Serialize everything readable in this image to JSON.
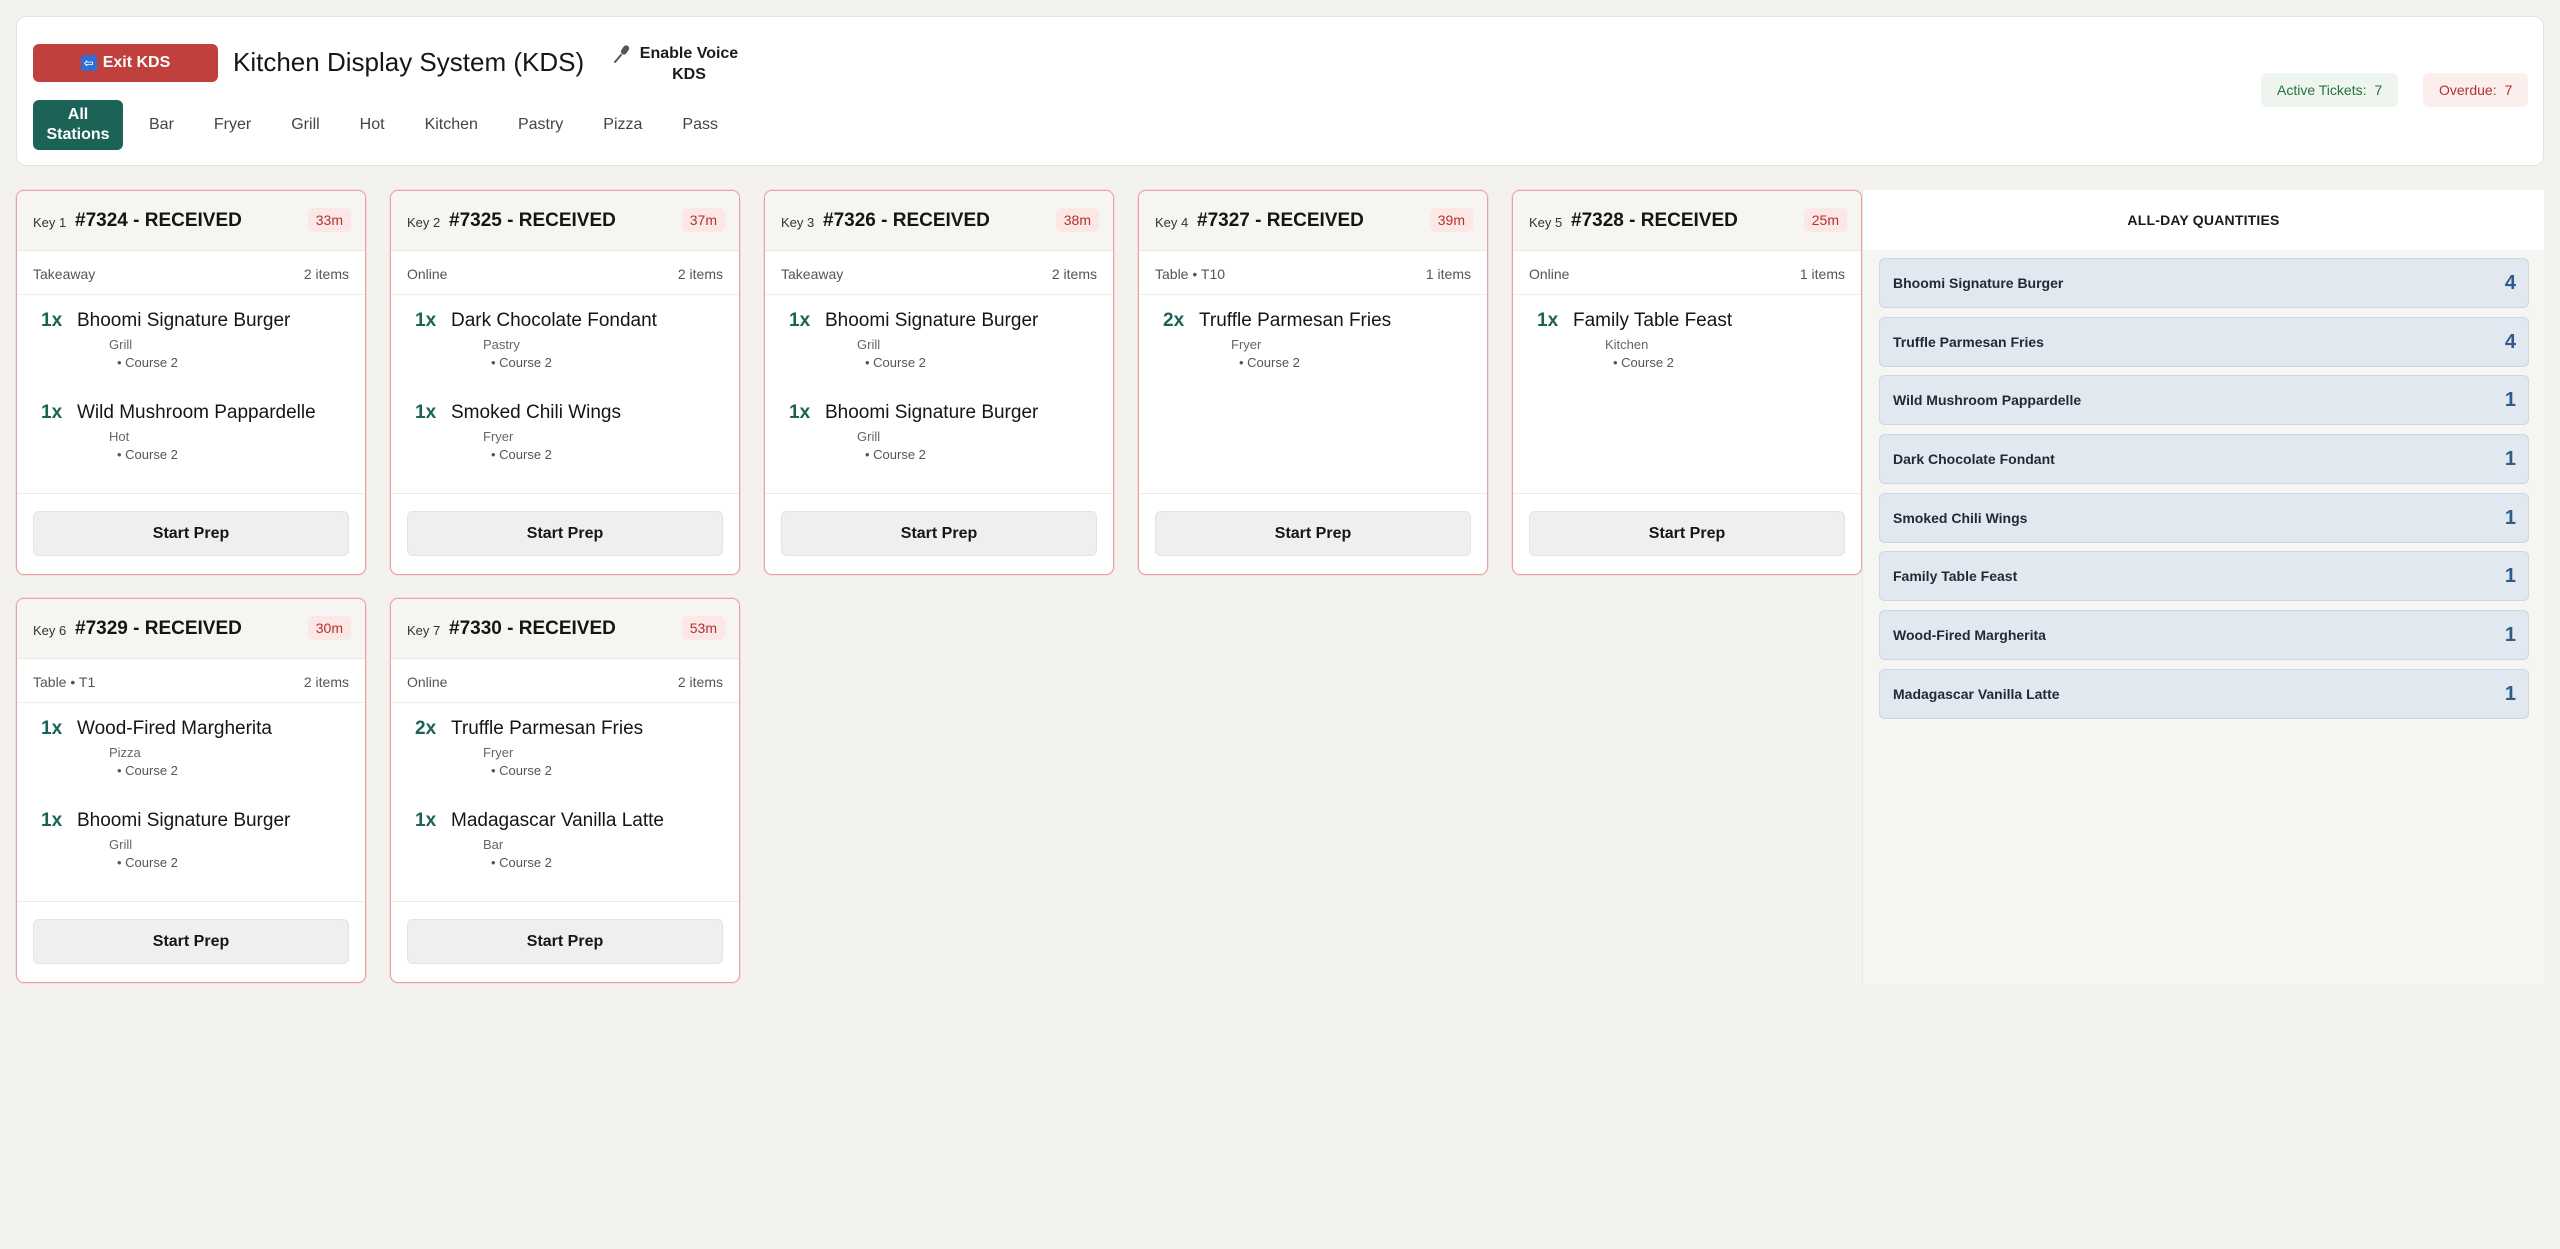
{
  "header": {
    "exit_label": "Exit KDS",
    "title": "Kitchen Display System (KDS)",
    "voice_label": "Enable Voice KDS",
    "stations": [
      "All Stations",
      "Bar",
      "Fryer",
      "Grill",
      "Hot",
      "Kitchen",
      "Pastry",
      "Pizza",
      "Pass"
    ],
    "active_station": "All Stations",
    "metrics": {
      "active_label": "Active Tickets:",
      "active_value": "7",
      "overdue_label": "Overdue:",
      "overdue_value": "7"
    }
  },
  "tickets": [
    {
      "key": "Key 1",
      "title": "#7324 - RECEIVED",
      "time": "33m",
      "type": "Takeaway",
      "count": "2 items",
      "items": [
        {
          "qty": "1x",
          "name": "Bhoomi Signature Burger",
          "station": "Grill",
          "course": "• Course 2"
        },
        {
          "qty": "1x",
          "name": "Wild Mushroom Pappardelle",
          "station": "Hot",
          "course": "• Course 2"
        }
      ],
      "action": "Start Prep"
    },
    {
      "key": "Key 2",
      "title": "#7325 - RECEIVED",
      "time": "37m",
      "type": "Online",
      "count": "2 items",
      "items": [
        {
          "qty": "1x",
          "name": "Dark Chocolate Fondant",
          "station": "Pastry",
          "course": "• Course 2"
        },
        {
          "qty": "1x",
          "name": "Smoked Chili Wings",
          "station": "Fryer",
          "course": "• Course 2"
        }
      ],
      "action": "Start Prep"
    },
    {
      "key": "Key 3",
      "title": "#7326 - RECEIVED",
      "time": "38m",
      "type": "Takeaway",
      "count": "2 items",
      "items": [
        {
          "qty": "1x",
          "name": "Bhoomi Signature Burger",
          "station": "Grill",
          "course": "• Course 2"
        },
        {
          "qty": "1x",
          "name": "Bhoomi Signature Burger",
          "station": "Grill",
          "course": "• Course 2"
        }
      ],
      "action": "Start Prep"
    },
    {
      "key": "Key 4",
      "title": "#7327 - RECEIVED",
      "time": "39m",
      "type": "Table • T10",
      "count": "1 items",
      "items": [
        {
          "qty": "2x",
          "name": "Truffle Parmesan Fries",
          "station": "Fryer",
          "course": "• Course 2"
        }
      ],
      "action": "Start Prep"
    },
    {
      "key": "Key 5",
      "title": "#7328 - RECEIVED",
      "time": "25m",
      "type": "Online",
      "count": "1 items",
      "items": [
        {
          "qty": "1x",
          "name": "Family Table Feast",
          "station": "Kitchen",
          "course": "• Course 2"
        }
      ],
      "action": "Start Prep"
    },
    {
      "key": "Key 6",
      "title": "#7329 - RECEIVED",
      "time": "30m",
      "type": "Table • T1",
      "count": "2 items",
      "items": [
        {
          "qty": "1x",
          "name": "Wood-Fired Margherita",
          "station": "Pizza",
          "course": "• Course 2"
        },
        {
          "qty": "1x",
          "name": "Bhoomi Signature Burger",
          "station": "Grill",
          "course": "• Course 2"
        }
      ],
      "action": "Start Prep"
    },
    {
      "key": "Key 7",
      "title": "#7330 - RECEIVED",
      "time": "53m",
      "type": "Online",
      "count": "2 items",
      "items": [
        {
          "qty": "2x",
          "name": "Truffle Parmesan Fries",
          "station": "Fryer",
          "course": "• Course 2"
        },
        {
          "qty": "1x",
          "name": "Madagascar Vanilla Latte",
          "station": "Bar",
          "course": "• Course 2"
        }
      ],
      "action": "Start Prep"
    }
  ],
  "all_day": {
    "title": "ALL-DAY QUANTITIES",
    "rows": [
      {
        "name": "Bhoomi Signature Burger",
        "qty": "4"
      },
      {
        "name": "Truffle Parmesan Fries",
        "qty": "4"
      },
      {
        "name": "Wild Mushroom Pappardelle",
        "qty": "1"
      },
      {
        "name": "Dark Chocolate Fondant",
        "qty": "1"
      },
      {
        "name": "Smoked Chili Wings",
        "qty": "1"
      },
      {
        "name": "Family Table Feast",
        "qty": "1"
      },
      {
        "name": "Wood-Fired Margherita",
        "qty": "1"
      },
      {
        "name": "Madagascar Vanilla Latte",
        "qty": "1"
      }
    ]
  },
  "colors": {
    "accent": "#1b6356",
    "exit": "#c0403e",
    "overdue": "#b2332f",
    "active": "#26733e"
  },
  "icons": {
    "exit": "back-arrow-icon",
    "voice": "microphone-icon"
  }
}
